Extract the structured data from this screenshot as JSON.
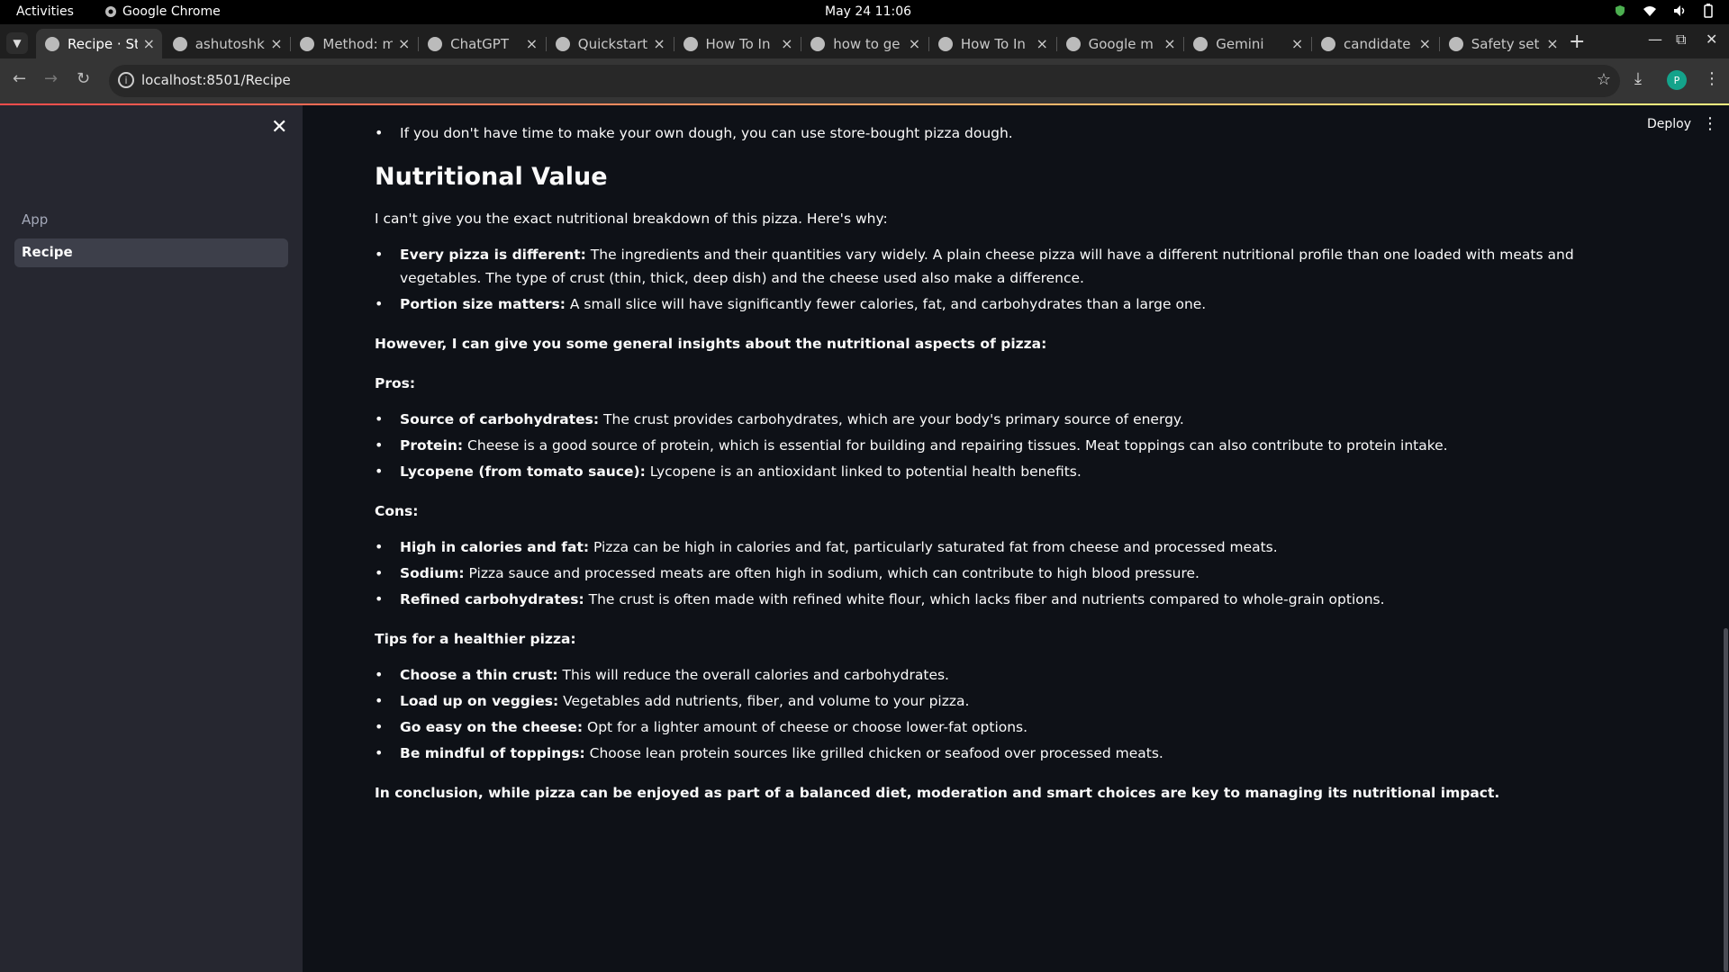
{
  "system_bar": {
    "activities": "Activities",
    "app_name": "Google Chrome",
    "clock": "May 24  11:06"
  },
  "browser": {
    "tabs": [
      {
        "title": "Recipe · St",
        "favicon": "streamlit-icon",
        "active": true
      },
      {
        "title": "ashutoshk",
        "favicon": "github-icon"
      },
      {
        "title": "Method: m",
        "favicon": "google-icon"
      },
      {
        "title": "ChatGPT",
        "favicon": "chatgpt-icon"
      },
      {
        "title": "Quickstart",
        "favicon": "quickstart-icon"
      },
      {
        "title": "How To In",
        "favicon": "digitalocean-icon"
      },
      {
        "title": "how to ge",
        "favicon": "google-icon"
      },
      {
        "title": "How To In",
        "favicon": "digitalocean-icon"
      },
      {
        "title": "Google m",
        "favicon": "google-cloud-icon"
      },
      {
        "title": "Gemini",
        "favicon": "gemini-icon"
      },
      {
        "title": "candidate",
        "favicon": "google-icon"
      },
      {
        "title": "Safety set",
        "favicon": "google-icon"
      }
    ],
    "url": "localhost:8501/Recipe",
    "profile_initial": "P"
  },
  "app": {
    "sidebar_nav": [
      {
        "label": "App",
        "active": false
      },
      {
        "label": "Recipe",
        "active": true
      }
    ],
    "deploy_label": "Deploy",
    "content": {
      "intro_tip": "If you don't have time to make your own dough, you can use store-bought pizza dough.",
      "heading": "Nutritional Value",
      "intro": "I can't give you the exact nutritional breakdown of this pizza. Here's why:",
      "reasons": [
        {
          "lead": "Every pizza is different:",
          "text": " The ingredients and their quantities vary widely. A plain cheese pizza will have a different nutritional profile than one loaded with meats and vegetables. The type of crust (thin, thick, deep dish) and the cheese used also make a difference."
        },
        {
          "lead": "Portion size matters:",
          "text": " A small slice will have significantly fewer calories, fat, and carbohydrates than a large one."
        }
      ],
      "insights_heading": "However, I can give you some general insights about the nutritional aspects of pizza:",
      "pros_heading": "Pros:",
      "pros": [
        {
          "lead": "Source of carbohydrates:",
          "text": " The crust provides carbohydrates, which are your body's primary source of energy."
        },
        {
          "lead": "Protein:",
          "text": " Cheese is a good source of protein, which is essential for building and repairing tissues. Meat toppings can also contribute to protein intake."
        },
        {
          "lead": "Lycopene (from tomato sauce):",
          "text": " Lycopene is an antioxidant linked to potential health benefits."
        }
      ],
      "cons_heading": "Cons:",
      "cons": [
        {
          "lead": "High in calories and fat:",
          "text": " Pizza can be high in calories and fat, particularly saturated fat from cheese and processed meats."
        },
        {
          "lead": "Sodium:",
          "text": " Pizza sauce and processed meats are often high in sodium, which can contribute to high blood pressure."
        },
        {
          "lead": "Refined carbohydrates:",
          "text": " The crust is often made with refined white flour, which lacks fiber and nutrients compared to whole-grain options."
        }
      ],
      "tips_heading": "Tips for a healthier pizza:",
      "tips": [
        {
          "lead": "Choose a thin crust:",
          "text": " This will reduce the overall calories and carbohydrates."
        },
        {
          "lead": "Load up on veggies:",
          "text": " Vegetables add nutrients, fiber, and volume to your pizza."
        },
        {
          "lead": "Go easy on the cheese:",
          "text": " Opt for a lighter amount of cheese or choose lower-fat options."
        },
        {
          "lead": "Be mindful of toppings:",
          "text": " Choose lean protein sources like grilled chicken or seafood over processed meats."
        }
      ],
      "conclusion": "In conclusion, while pizza can be enjoyed as part of a balanced diet, moderation and smart choices are key to managing its nutritional impact."
    }
  },
  "colors": {
    "app_background": "#0e1117",
    "sidebar_background": "#262730",
    "text": "#fafafa",
    "decoration_start": "#ff4b4b",
    "decoration_end": "#fffd80"
  }
}
